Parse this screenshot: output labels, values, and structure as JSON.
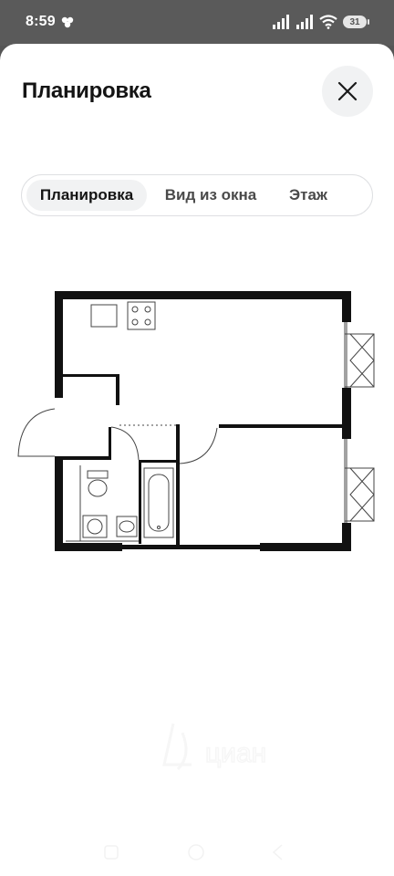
{
  "status_bar": {
    "time": "8:59",
    "battery_level": "31",
    "icons": [
      "app-notification-icon",
      "signal-icon",
      "signal-icon",
      "wifi-icon",
      "battery-icon"
    ]
  },
  "sheet": {
    "title": "Планировка",
    "close_icon": "close-icon"
  },
  "tabs": [
    {
      "label": "Планировка",
      "active": true
    },
    {
      "label": "Вид из окна",
      "active": false
    },
    {
      "label": "Этаж",
      "active": false
    }
  ],
  "floorplan": {
    "image": "apartment-floor-plan",
    "colors": {
      "walls": "#111111",
      "fixtures": "#444444"
    }
  },
  "watermark": {
    "brand": "cian-watermark"
  },
  "nav_bar": {
    "buttons": [
      "back-button",
      "home-button",
      "recents-button"
    ]
  }
}
